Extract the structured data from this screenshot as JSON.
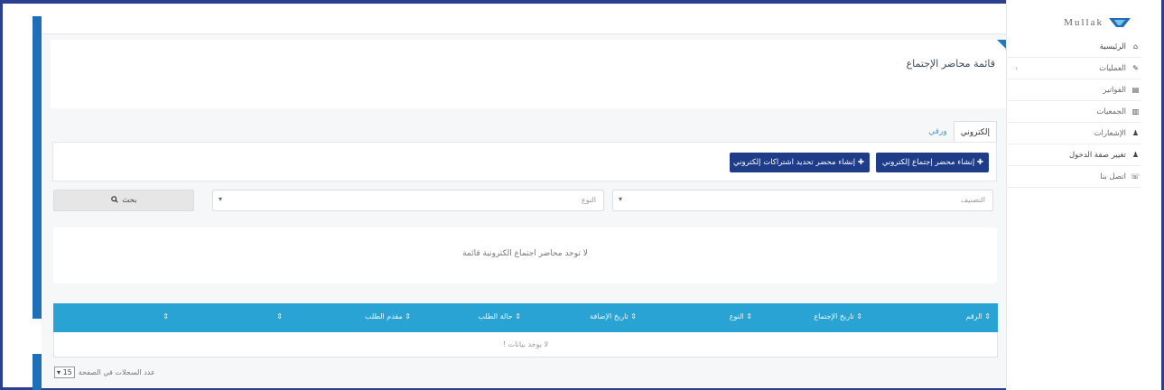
{
  "app": {
    "logo_text": "Mullak",
    "brand_color": "#1e6fb8",
    "accent_color": "#28a3d3",
    "button_color": "#1f3c88"
  },
  "sidebar": {
    "items": [
      {
        "label": "الرئيسية",
        "icon": "home-icon",
        "glyph": "⌂"
      },
      {
        "label": "العمليات",
        "icon": "edit-icon",
        "glyph": "✎",
        "has_children": true
      },
      {
        "label": "الفواتير",
        "icon": "invoice-icon",
        "glyph": "▤"
      },
      {
        "label": "الجمعيات",
        "icon": "building-icon",
        "glyph": "▥"
      },
      {
        "label": "الإشعارات",
        "icon": "bell-icon",
        "glyph": "♟"
      },
      {
        "label": "تغيير صفة الدخول",
        "icon": "user-icon",
        "glyph": "♟"
      },
      {
        "label": "اتصل بنا",
        "icon": "phone-icon",
        "glyph": "☏"
      }
    ],
    "chevron": "‹"
  },
  "page": {
    "title": "قائمة محاضر الإجتماع"
  },
  "tabs": [
    {
      "label": "إلكتروني",
      "active": true
    },
    {
      "label": "ورقي",
      "active": false
    }
  ],
  "actions": {
    "create_electronic": "✚ إنشاء محضر إجتماع إلكتروني",
    "create_subscription_update": "✚ إنشاء محضر تحديد اشتراكات إلكتروني"
  },
  "filters": {
    "classification_label": "التصنيف",
    "type_label": "النوع",
    "search_button": "بحث",
    "caret": "▾"
  },
  "empty_state": {
    "message": "لا توجد محاضر اجتماع الكترونية قائمة"
  },
  "table": {
    "columns": [
      "⇕ الرقم",
      "⇕ تاريخ الإجتماع",
      "⇕ النوع",
      "⇕ تاريخ الإضافة",
      "⇕ حالة الطلب",
      "⇕ مقدم الطلب",
      "⇕",
      "⇕"
    ],
    "empty_message": "لا يوجد بيانات !"
  },
  "pagination": {
    "label": "عدد السجلات في الصفحة",
    "page_size": "15"
  }
}
